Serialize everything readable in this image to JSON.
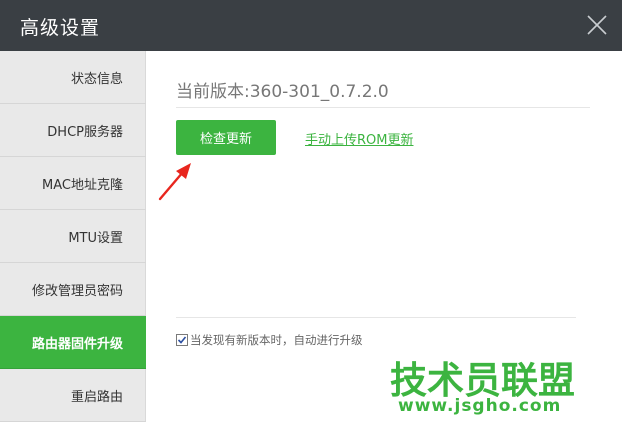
{
  "window": {
    "title": "高级设置",
    "close_icon": "close-icon"
  },
  "sidebar": {
    "items": [
      {
        "label": "状态信息",
        "active": false
      },
      {
        "label": "DHCP服务器",
        "active": false
      },
      {
        "label": "MAC地址克隆",
        "active": false
      },
      {
        "label": "MTU设置",
        "active": false
      },
      {
        "label": "修改管理员密码",
        "active": false
      },
      {
        "label": "路由器固件升级",
        "active": true
      },
      {
        "label": "重启路由",
        "active": false
      }
    ]
  },
  "main": {
    "version_text": "当前版本:360-301_0.7.2.0",
    "check_update_label": "检查更新",
    "manual_upload_label": "手动上传ROM更新",
    "auto_upgrade_checked": true,
    "auto_upgrade_label": "当发现有新版本时，自动进行升级"
  },
  "watermark": {
    "title": "技术员联盟",
    "url": "www.jsgho.com"
  },
  "colors": {
    "titlebar": "#3a3f44",
    "accent_green": "#3cb440",
    "sidebar_bg": "#e9e9e9",
    "arrow_red": "#e8261e"
  }
}
